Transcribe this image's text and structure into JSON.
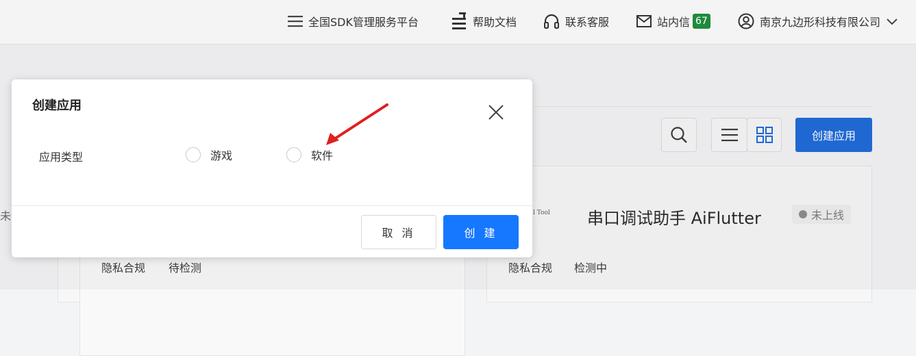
{
  "topnav": {
    "items": [
      {
        "icon": "menu-icon",
        "label": "全国SDK管理服务平台"
      },
      {
        "icon": "document-icon",
        "label": "帮助文档"
      },
      {
        "icon": "headset-icon",
        "label": "联系客服"
      },
      {
        "icon": "mail-icon",
        "label": "站内信",
        "badge": "67"
      },
      {
        "icon": "user-icon",
        "label": "南京九边形科技有限公司"
      }
    ]
  },
  "background": {
    "create_button": "创建应用",
    "card_left": {
      "label": "隐私合规",
      "status": "待检测",
      "edge_text": "未"
    },
    "card_right": {
      "title": "串口调试助手 AiFlutter",
      "status_pill": "未上线",
      "label": "隐私合规",
      "status": "检测中",
      "thumb_text": "l Tool"
    }
  },
  "modal": {
    "title": "创建应用",
    "field_label": "应用类型",
    "options": [
      "游戏",
      "软件"
    ],
    "cancel": "取 消",
    "create": "创 建"
  },
  "colors": {
    "primary": "#1677ff",
    "badge": "#1f8a3c",
    "arrow": "#e02020"
  }
}
